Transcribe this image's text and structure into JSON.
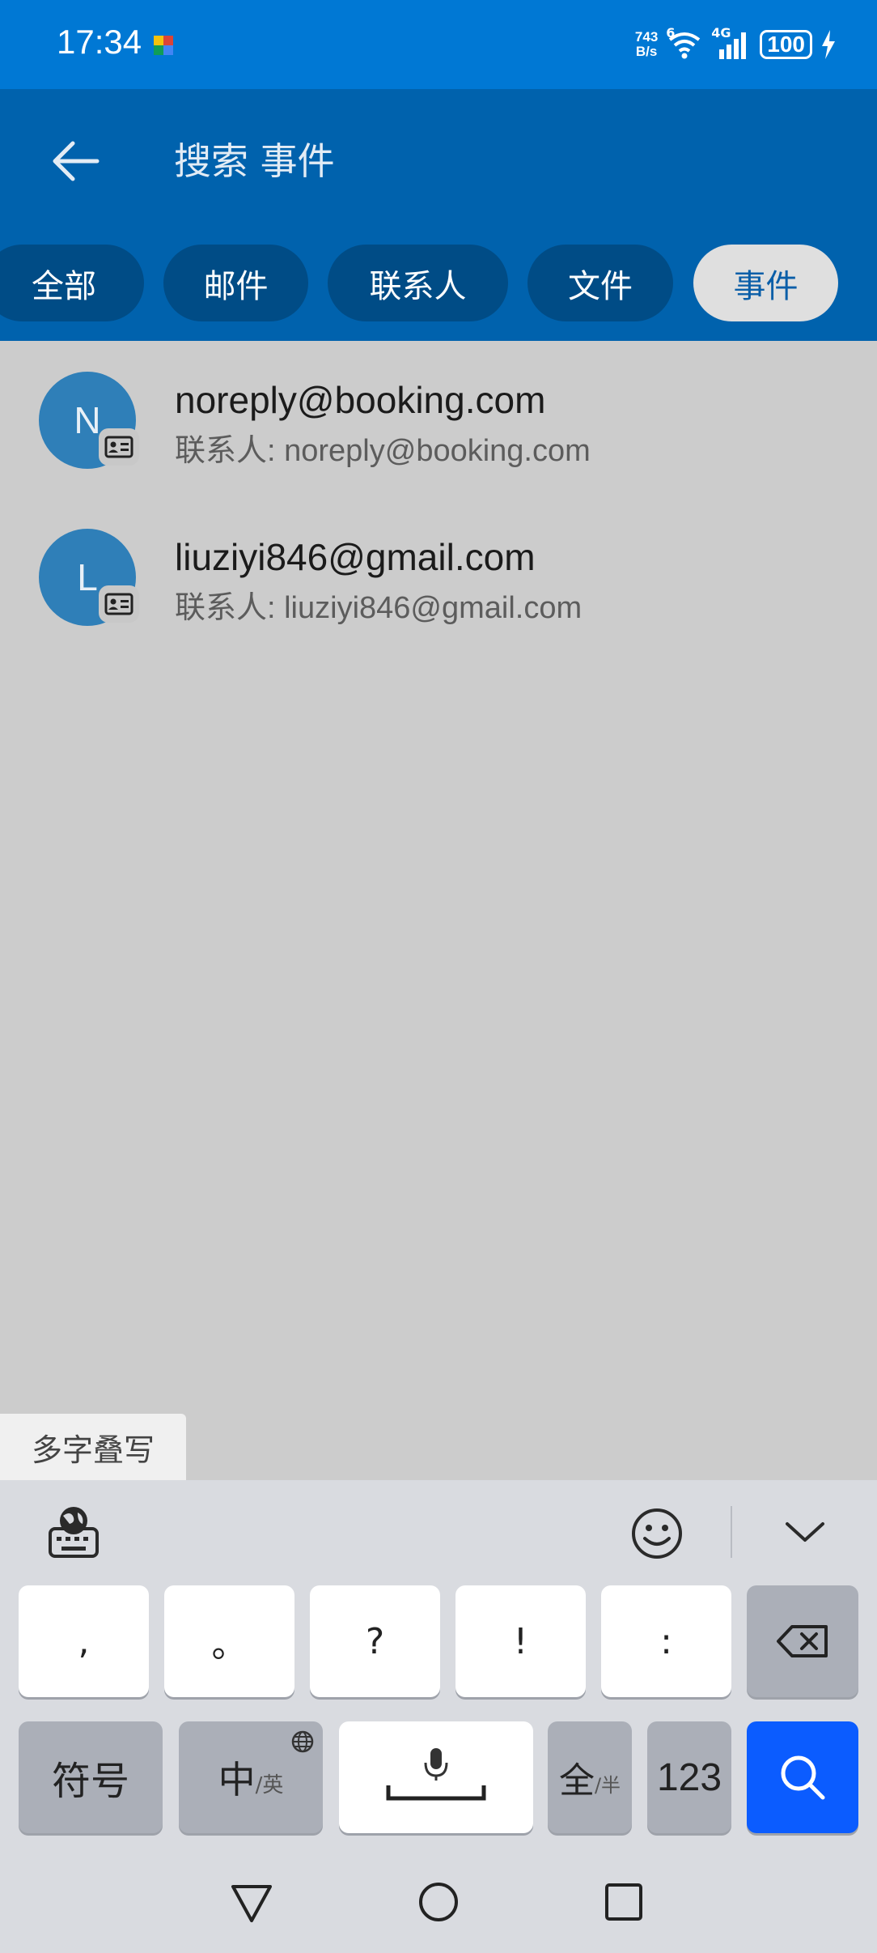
{
  "status_bar": {
    "time": "17:34",
    "net_speed_top": "743",
    "net_speed_bottom": "B/s",
    "wifi_badge": "6",
    "signal_label": "4G",
    "battery": "100",
    "icons": [
      "app-notification-icon",
      "wifi-icon",
      "signal-icon",
      "battery-icon",
      "charging-icon"
    ]
  },
  "header": {
    "back_icon": "arrow-left-icon",
    "title": "搜索 事件"
  },
  "filters": {
    "all": "全部",
    "mail": "邮件",
    "contacts": "联系人",
    "files": "文件",
    "events": "事件",
    "active": "事件"
  },
  "results": [
    {
      "initial": "N",
      "title": "noreply@booking.com",
      "subtitle": "联系人: noreply@booking.com",
      "badge_icon": "contact-card-icon"
    },
    {
      "initial": "L",
      "title": "liuziyi846@gmail.com",
      "subtitle": "联系人: liuziyi846@gmail.com",
      "badge_icon": "contact-card-icon"
    }
  ],
  "ime": {
    "handwriting_tab": "多字叠写",
    "toolbar_icons": [
      "keyboard-globe-icon",
      "emoji-icon",
      "collapse-keyboard-icon"
    ],
    "row1": [
      ",",
      "。",
      "?",
      "!",
      ":"
    ],
    "backspace_icon": "backspace-icon",
    "symbols": "符号",
    "lang_main": "中",
    "lang_sub": "/英",
    "space_icon": "microphone-icon",
    "width_main": "全",
    "width_sub": "/半",
    "numbers": "123",
    "search_icon": "search-icon"
  },
  "nav_bar": {
    "icons": [
      "back-triangle-icon",
      "home-circle-icon",
      "recents-square-icon"
    ]
  },
  "colors": {
    "status_bar": "#0078d4",
    "app_bar": "#0062ad",
    "chip": "#004c86",
    "avatar": "#2f7fb8",
    "search_key": "#0b5cff"
  }
}
